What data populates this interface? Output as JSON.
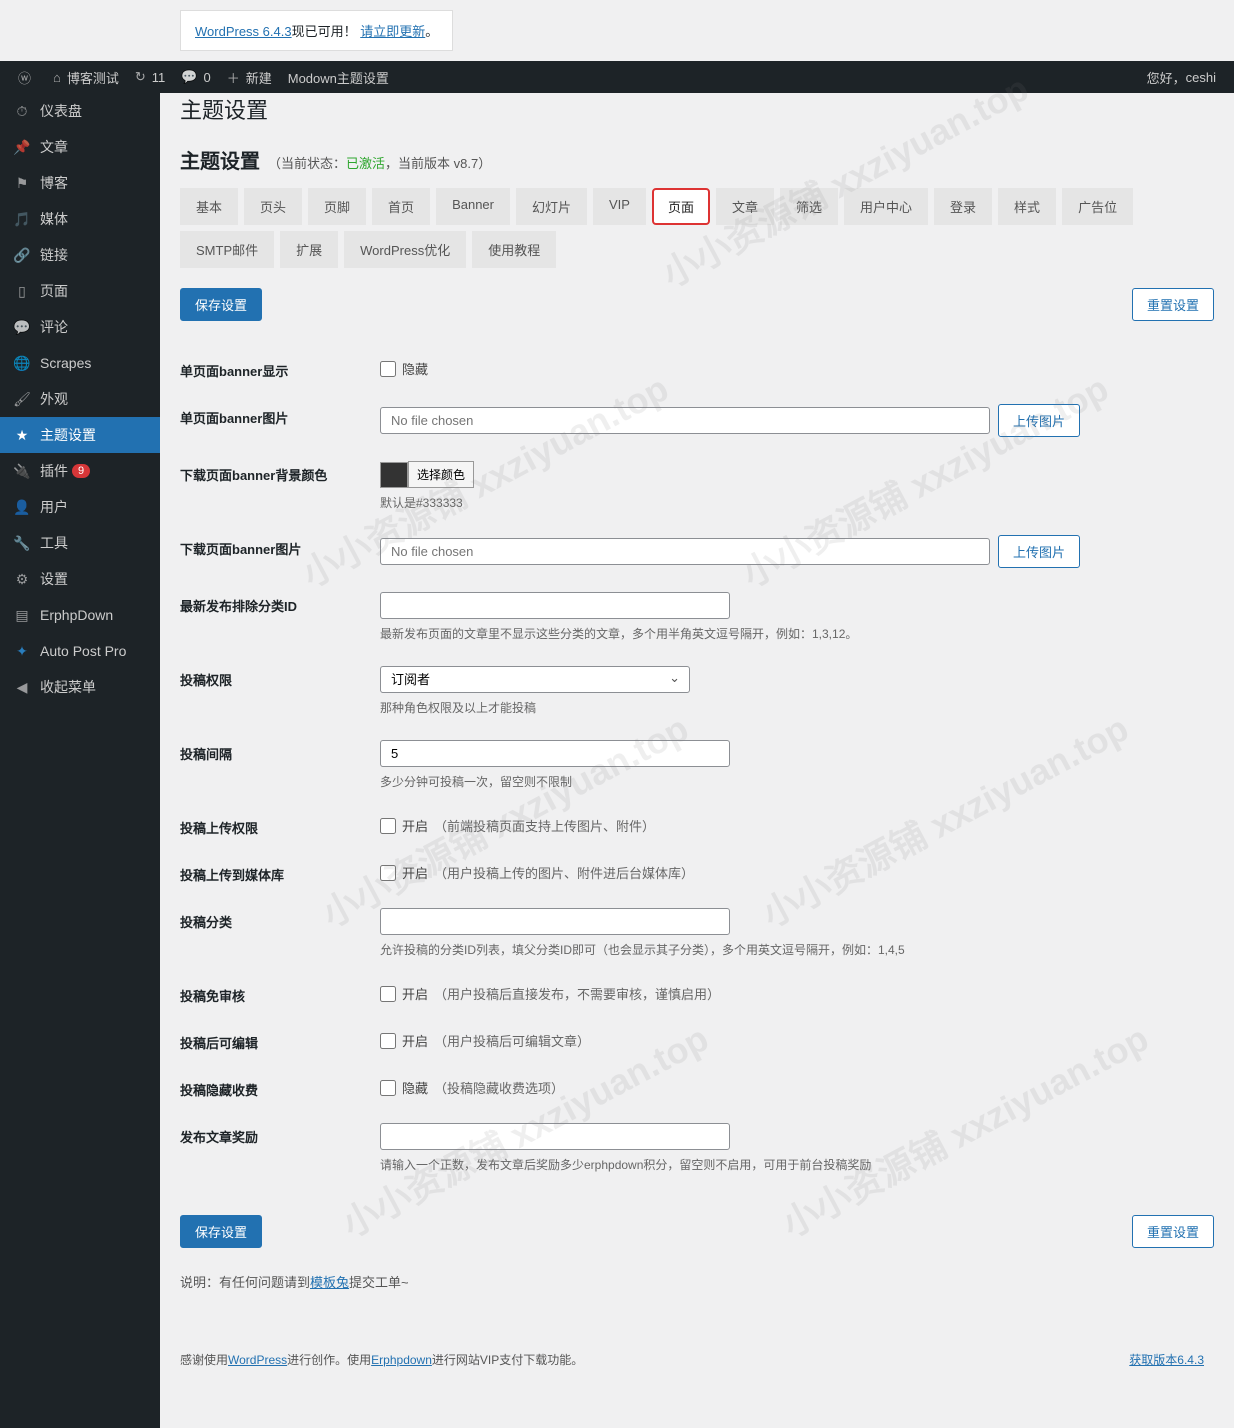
{
  "update_notice": {
    "version_text": "WordPress 6.4.3",
    "available_text": "现已可用！",
    "update_link": "请立即更新",
    "suffix": "。"
  },
  "adminbar": {
    "site_name": "博客测试",
    "counts": {
      "refresh": "11",
      "comments": "0"
    },
    "new_label": "新建",
    "extra": "Modown主题设置",
    "greeting": "您好，",
    "user": "ceshi"
  },
  "sidebar": [
    {
      "icon": "dashboard",
      "label": "仪表盘"
    },
    {
      "icon": "pin",
      "label": "文章"
    },
    {
      "icon": "flag",
      "label": "博客"
    },
    {
      "icon": "media",
      "label": "媒体"
    },
    {
      "icon": "link",
      "label": "链接"
    },
    {
      "icon": "page",
      "label": "页面"
    },
    {
      "icon": "comment",
      "label": "评论"
    },
    {
      "icon": "globe",
      "label": "Scrapes"
    },
    {
      "icon": "brush",
      "label": "外观"
    },
    {
      "icon": "star",
      "label": "主题设置",
      "current": true
    },
    {
      "icon": "plugin",
      "label": "插件",
      "badge": "9"
    },
    {
      "icon": "user",
      "label": "用户"
    },
    {
      "icon": "tool",
      "label": "工具"
    },
    {
      "icon": "settings",
      "label": "设置"
    },
    {
      "icon": "erphp",
      "label": "ErphpDown"
    },
    {
      "icon": "auto",
      "label": "Auto Post Pro"
    },
    {
      "icon": "collapse",
      "label": "收起菜单"
    }
  ],
  "heading_over": "主题设置",
  "heading": "主题设置",
  "status": {
    "prefix": "（当前状态：",
    "active": "已激活",
    "sep": "，",
    "version": "当前版本 v8.7",
    "suffix": "）"
  },
  "tabs": [
    "基本",
    "页头",
    "页脚",
    "首页",
    "Banner",
    "幻灯片",
    "VIP",
    "页面",
    "文章",
    "筛选",
    "用户中心",
    "登录",
    "样式",
    "广告位",
    "SMTP邮件",
    "扩展",
    "WordPress优化",
    "使用教程"
  ],
  "active_tab": "页面",
  "buttons": {
    "save": "保存设置",
    "reset": "重置设置",
    "upload": "上传图片",
    "choose_color": "选择颜色"
  },
  "form": {
    "banner_show": {
      "label": "单页面banner显示",
      "hide_text": "隐藏"
    },
    "banner_img": {
      "label": "单页面banner图片",
      "placeholder": "No file chosen"
    },
    "dl_banner_color": {
      "label": "下载页面banner背景颜色",
      "swatch": "#333333",
      "desc": "默认是#333333"
    },
    "dl_banner_img": {
      "label": "下载页面banner图片",
      "placeholder": "No file chosen"
    },
    "exclude_cat": {
      "label": "最新发布排除分类ID",
      "desc": "最新发布页面的文章里不显示这些分类的文章，多个用半角英文逗号隔开，例如：1,3,12。"
    },
    "submit_role": {
      "label": "投稿权限",
      "value": "订阅者",
      "desc": "那种角色权限及以上才能投稿"
    },
    "submit_interval": {
      "label": "投稿间隔",
      "value": "5",
      "desc": "多少分钟可投稿一次，留空则不限制"
    },
    "submit_upload": {
      "label": "投稿上传权限",
      "option": "开启",
      "hint": "（前端投稿页面支持上传图片、附件）"
    },
    "submit_media": {
      "label": "投稿上传到媒体库",
      "option": "开启",
      "hint": "（用户投稿上传的图片、附件进后台媒体库）"
    },
    "submit_cat": {
      "label": "投稿分类",
      "desc": "允许投稿的分类ID列表，填父分类ID即可（也会显示其子分类），多个用英文逗号隔开，例如：1,4,5"
    },
    "submit_noreview": {
      "label": "投稿免审核",
      "option": "开启",
      "hint": "（用户投稿后直接发布，不需要审核，谨慎启用）"
    },
    "submit_editable": {
      "label": "投稿后可编辑",
      "option": "开启",
      "hint": "（用户投稿后可编辑文章）"
    },
    "submit_hidefee": {
      "label": "投稿隐藏收费",
      "option": "隐藏",
      "hint": "（投稿隐藏收费选项）"
    },
    "publish_reward": {
      "label": "发布文章奖励",
      "desc": "请输入一个正数，发布文章后奖励多少erphpdown积分，留空则不启用，可用于前台投稿奖励"
    }
  },
  "explain": {
    "prefix": "说明：有任何问题请到",
    "link": "模板兔",
    "suffix": "提交工单~"
  },
  "footer": {
    "thanks": "感谢使用",
    "wp": "WordPress",
    "t1": "进行创作。使用",
    "erphp": "Erphpdown",
    "t2": "进行网站VIP支付下载功能。",
    "version": "获取版本6.4.3"
  }
}
